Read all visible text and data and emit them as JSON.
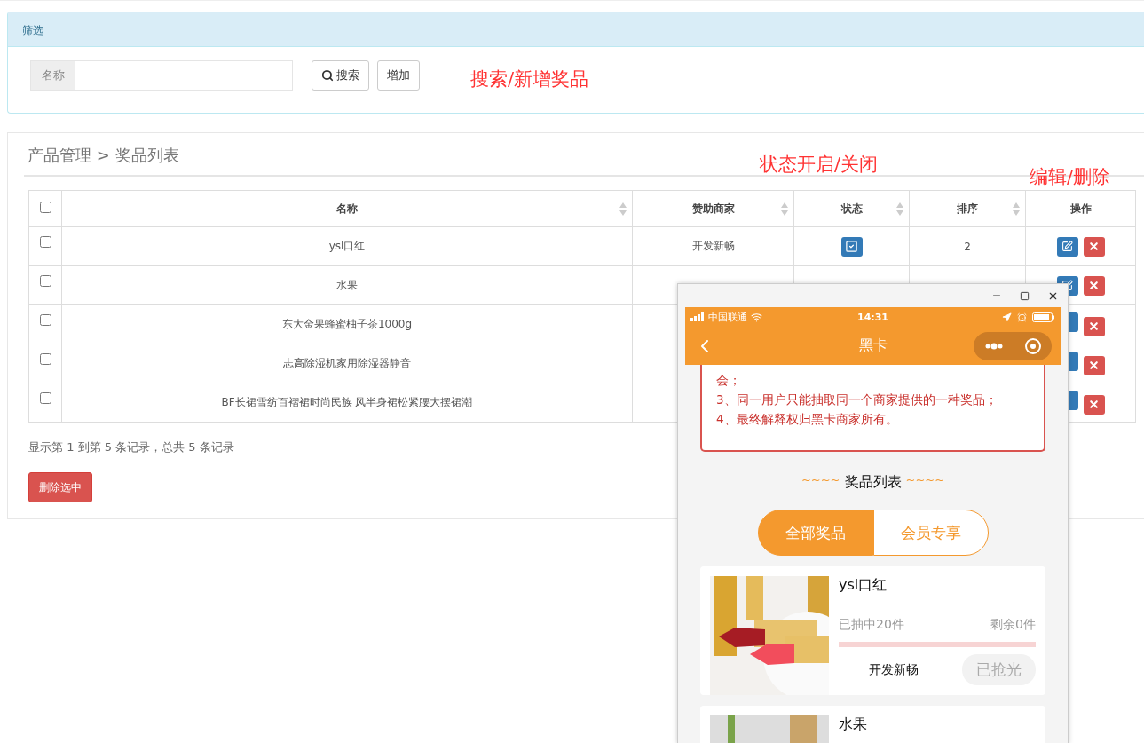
{
  "filter": {
    "title": "筛选",
    "name_label": "名称",
    "search_button": "搜索",
    "add_button": "增加"
  },
  "annotations": [
    {
      "text": "搜索/新增奖品"
    },
    {
      "text": "状态开启/关闭"
    },
    {
      "text": "编辑/删除"
    }
  ],
  "breadcrumb": "产品管理 > 奖品列表",
  "table": {
    "header_checked": false,
    "columns": [
      {
        "label": "名称",
        "sortable": true
      },
      {
        "label": "赞助商家",
        "sortable": true
      },
      {
        "label": "状态",
        "sortable": true
      },
      {
        "label": "排序",
        "sortable": true
      },
      {
        "label": "操作",
        "sortable": false
      }
    ],
    "rows": [
      {
        "checked": false,
        "name": "ysl口红",
        "sponsor": "开发新畅",
        "status_on": true,
        "sort": "2"
      },
      {
        "checked": false,
        "name": "水果"
      },
      {
        "checked": false,
        "name": "东大金果蜂蜜柚子茶1000g"
      },
      {
        "checked": false,
        "name": "志高除湿机家用除湿器静音"
      },
      {
        "checked": false,
        "name": "BF长裙雪纺百褶裙时尚民族 风半身裙松紧腰大摆裙潮"
      }
    ]
  },
  "summary": "显示第 1 到第 5 条记录，总共 5 条记录",
  "delete_selected_button": "删除选中",
  "phone": {
    "status_bar": {
      "carrier": "中国联通",
      "time": "14:31"
    },
    "nav_title": "黑卡",
    "rules": [
      "会；",
      "3、同一用户只能抽取同一个商家提供的一种奖品；",
      "4、最终解释权归黑卡商家所有。"
    ],
    "section_title": {
      "left": "~~~~",
      "text": "奖品列表",
      "right": "~~~~"
    },
    "tabs": [
      {
        "label": "全部奖品",
        "selected": true
      },
      {
        "label": "会员专享",
        "selected": false
      }
    ],
    "prizes": [
      {
        "name": "ysl口红",
        "drawn": "已抽中20件",
        "remaining": "剩余0件",
        "level": 1,
        "sponsor": "开发新畅",
        "button": "已抢光"
      },
      {
        "name": "水果"
      }
    ]
  }
}
